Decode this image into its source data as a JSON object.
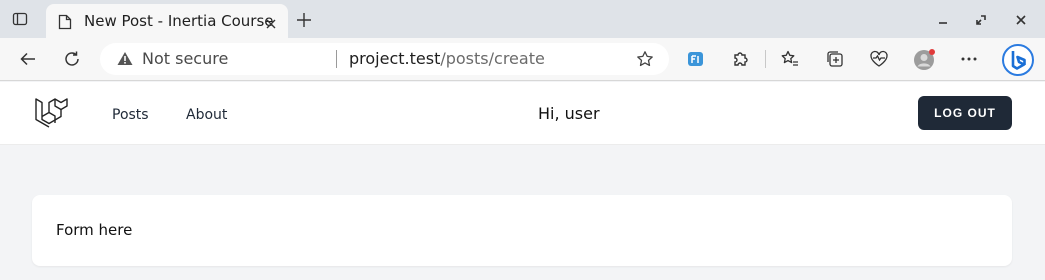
{
  "browser": {
    "tab": {
      "title": "New Post - Inertia Course",
      "icon": "page-icon"
    },
    "security_label": "Not secure",
    "url_host": "project.test",
    "url_path": "/posts/create",
    "icons": [
      "tab-actions-icon",
      "close-icon",
      "new-tab-icon",
      "minimize-icon",
      "restore-icon",
      "window-close-icon",
      "back-icon",
      "refresh-icon",
      "warning-icon",
      "favorite-star-icon",
      "extension-fi-icon",
      "extensions-puzzle-icon",
      "favorites-icon",
      "collections-icon",
      "browser-essentials-icon",
      "profile-avatar-icon",
      "more-menu-icon",
      "bing-icon"
    ],
    "colors": {
      "tabstrip": "#dfe3e8",
      "toolbar": "#f7f7f7",
      "bing": "#1a6fd6",
      "profile_dot": "#e03b3b"
    }
  },
  "app": {
    "nav": {
      "posts": "Posts",
      "about": "About"
    },
    "greeting": "Hi, user",
    "logout_label": "LOG OUT",
    "colors": {
      "logout_bg": "#1f2937",
      "page_bg": "#f3f4f6"
    }
  },
  "main": {
    "card_text": "Form here"
  }
}
